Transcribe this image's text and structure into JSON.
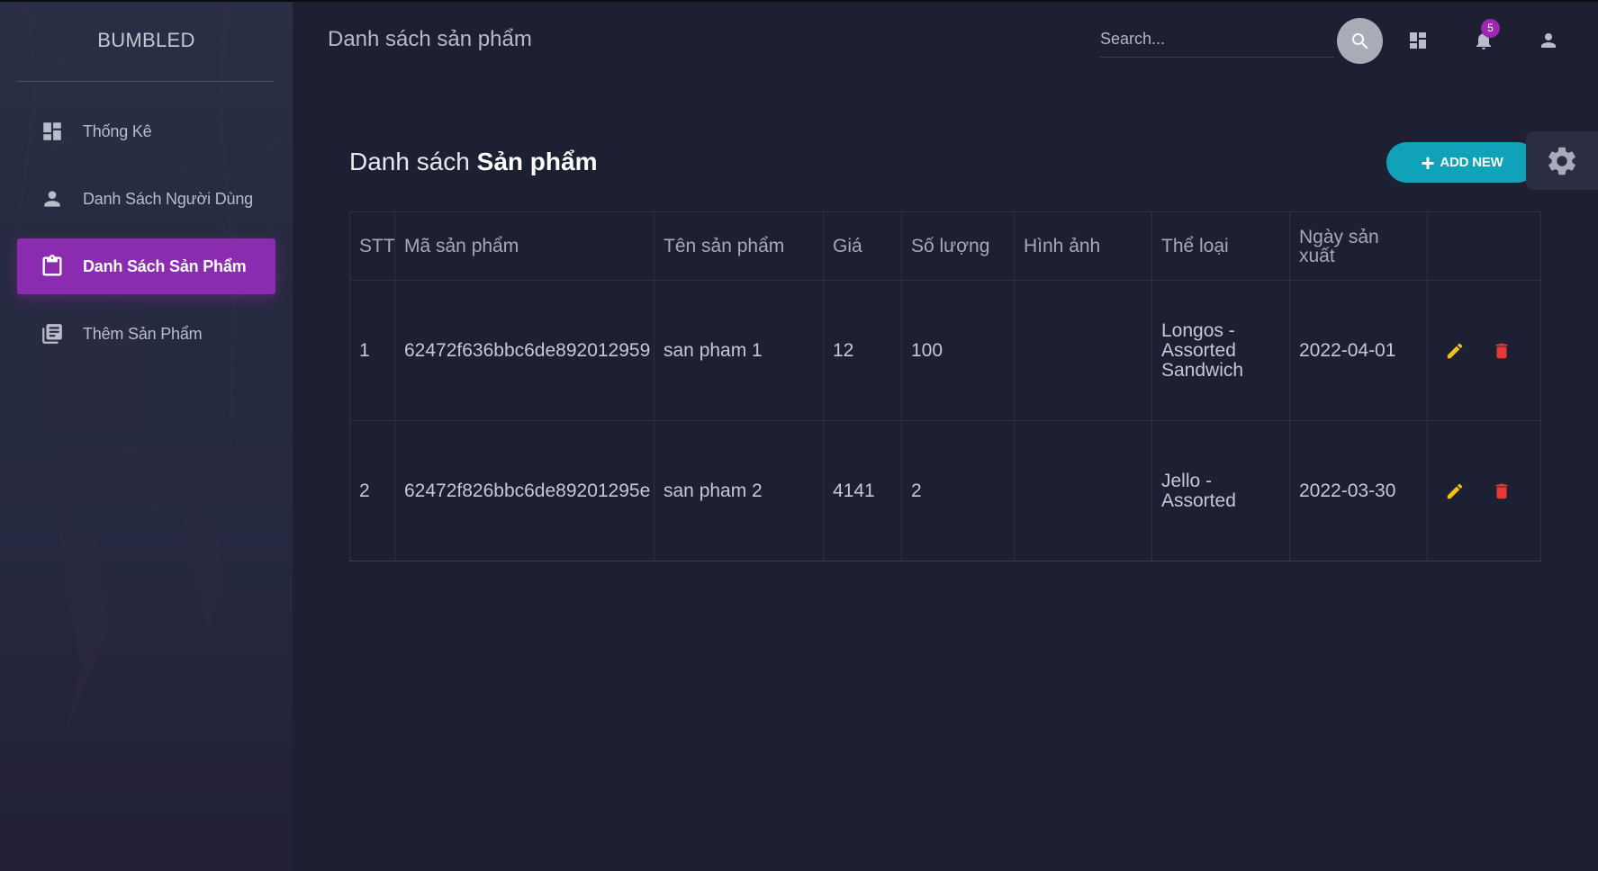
{
  "sidebar": {
    "brand": "BUMBLED",
    "items": [
      {
        "label": "Thống Kê",
        "icon": "dashboard-icon"
      },
      {
        "label": "Danh Sách Người Dùng",
        "icon": "person-icon"
      },
      {
        "label": "Danh Sách Sản Phẩm",
        "icon": "clipboard-icon",
        "active": true
      },
      {
        "label": "Thêm Sản Phẩm",
        "icon": "library-books-icon"
      }
    ]
  },
  "header": {
    "title": "Danh sách sản phẩm",
    "search_placeholder": "Search...",
    "notification_count": "5"
  },
  "content": {
    "title_prefix": "Danh sách",
    "title_bold": "Sản phẩm",
    "add_button_label": "ADD NEW"
  },
  "table": {
    "columns": [
      "STT",
      "Mã sản phẩm",
      "Tên sản phẩm",
      "Giá",
      "Số lượng",
      "Hình ảnh",
      "Thể loại",
      "Ngày sản xuất",
      ""
    ],
    "rows": [
      {
        "stt": "1",
        "id": "62472f636bbc6de892012959",
        "name": "san pham 1",
        "price": "12",
        "qty": "100",
        "image": "",
        "category": "Longos - Assorted Sandwich",
        "date": "2022-04-01"
      },
      {
        "stt": "2",
        "id": "62472f826bbc6de89201295e",
        "name": "san pham 2",
        "price": "4141",
        "qty": "2",
        "image": "",
        "category": "Jello - Assorted",
        "date": "2022-03-30"
      }
    ]
  },
  "colors": {
    "background": "#1d1f33",
    "accent_purple": "#8b2bb0",
    "accent_teal": "#0fa2b8",
    "edit_yellow": "#f4c20d",
    "delete_red": "#e53935"
  }
}
